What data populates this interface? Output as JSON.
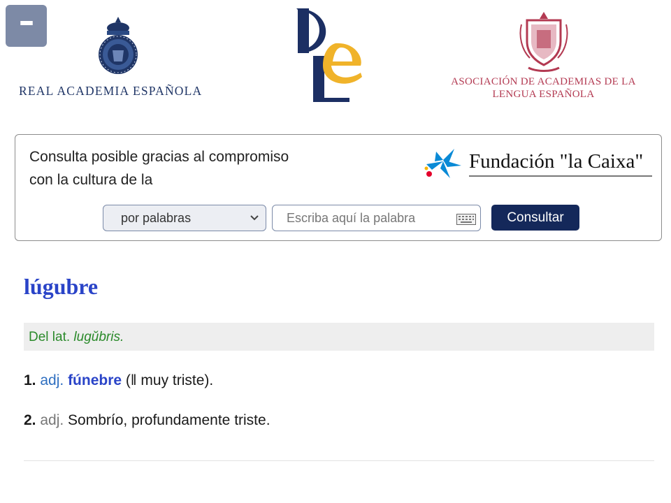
{
  "header": {
    "menu_icon": "hamburger-icon",
    "rae_name": "REAL ACADEMIA ESPAÑOLA",
    "dle_logo": "DLE monogram",
    "asale_line1": "ASOCIACIÓN DE ACADEMIAS DE LA",
    "asale_line2": "LENGUA ESPAÑOLA"
  },
  "search": {
    "sponsor_line1": "Consulta posible gracias al compromiso",
    "sponsor_line2": "con la cultura de la",
    "sponsor_name": "Fundación \"la Caixa\"",
    "mode_selected": "por palabras",
    "input_placeholder": "Escriba aquí la palabra",
    "input_value": "",
    "submit_label": "Consultar",
    "keyboard_icon": "keyboard-icon"
  },
  "entry": {
    "title": "lúgubre",
    "etymology_prefix": "Del lat.",
    "etymology_word": "lugŭbris.",
    "definitions": [
      {
        "num": "1.",
        "abbr": "adj.",
        "link": "fúnebre",
        "text": " (‖ muy triste)."
      },
      {
        "num": "2.",
        "abbr": "adj.",
        "text": " Sombrío, profundamente triste."
      }
    ]
  },
  "colors": {
    "brand_navy": "#14285a",
    "entry_blue": "#2a44c8",
    "etymology_green": "#2b8a2b",
    "asale_red": "#b33a52",
    "menu_button": "#7d8aa6"
  }
}
